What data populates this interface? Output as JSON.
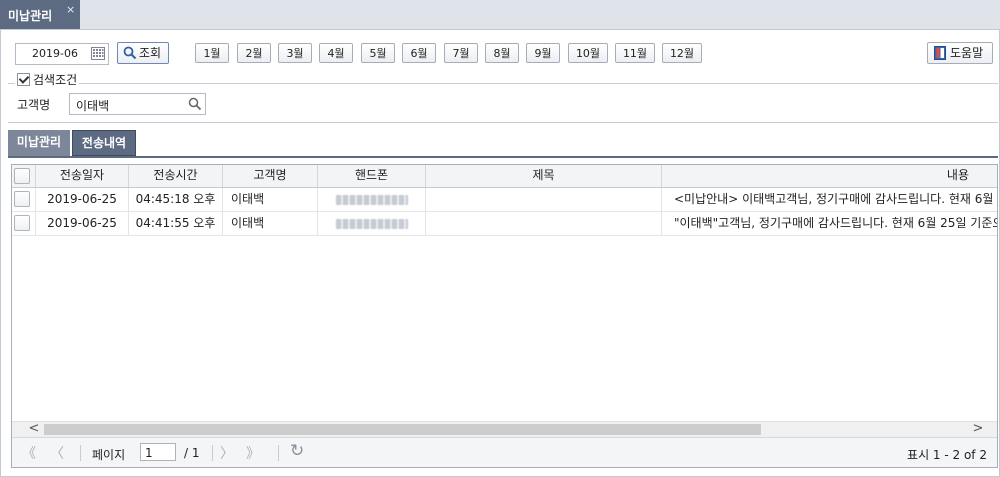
{
  "window": {
    "tab_title": "미납관리",
    "close_glyph": "×"
  },
  "toolbar": {
    "date_value": "2019-06",
    "search_label": "조회",
    "months": [
      "1월",
      "2월",
      "3월",
      "4월",
      "5월",
      "6월",
      "7월",
      "8월",
      "9월",
      "10월",
      "11월",
      "12월"
    ],
    "help_label": "도움말"
  },
  "search_conditions": {
    "title": "검색조건",
    "checked": true,
    "customer_label": "고객명",
    "customer_value": "이태백"
  },
  "sub_tabs": [
    {
      "label": "미납관리",
      "active": false
    },
    {
      "label": "전송내역",
      "active": true
    }
  ],
  "grid": {
    "columns": [
      "",
      "전송일자",
      "전송시간",
      "고객명",
      "핸드폰",
      "제목",
      "내용"
    ],
    "rows": [
      {
        "date": "2019-06-25",
        "time": "04:45:18 오후",
        "customer": "이태백",
        "phone": "",
        "subject": "",
        "content": "<미납안내> 이태백고객님, 정기구매에 감사드립니다. 현재 6월 2"
      },
      {
        "date": "2019-06-25",
        "time": "04:41:55 오후",
        "customer": "이태백",
        "phone": "",
        "subject": "",
        "content": "\"이태백\"고객님, 정기구매에 감사드립니다. 현재 6월 25일 기준으"
      }
    ]
  },
  "pager": {
    "page_label": "페이지",
    "current_page": "1",
    "total_pages": "/ 1",
    "info": "표시 1 - 2 of 2",
    "first_glyph": "《",
    "prev_glyph": "〈",
    "next_glyph": "〉",
    "last_glyph": "》",
    "refresh_glyph": "↻",
    "scroll_left_glyph": "<",
    "scroll_right_glyph": ">"
  },
  "colors": {
    "accent": "#5c6a82",
    "tab_inactive": "#7c879a"
  }
}
